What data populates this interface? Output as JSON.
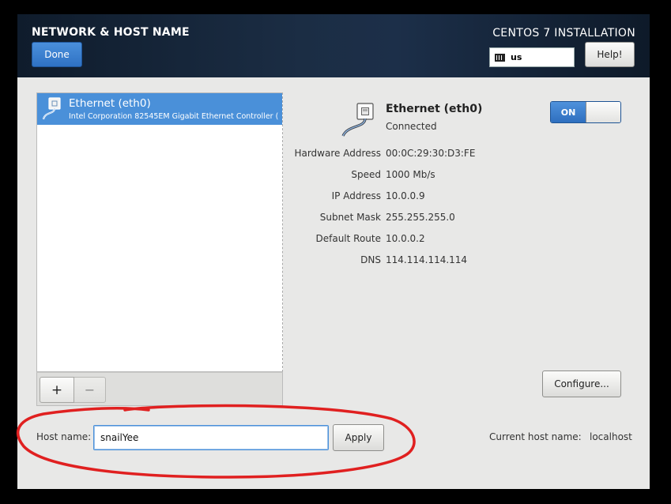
{
  "header": {
    "title": "NETWORK & HOST NAME",
    "done_label": "Done",
    "install_title": "CENTOS 7 INSTALLATION",
    "keyboard_layout": "us",
    "help_label": "Help!"
  },
  "device_list": {
    "items": [
      {
        "name": "Ethernet (eth0)",
        "description": "Intel Corporation 82545EM Gigabit Ethernet Controller ("
      }
    ],
    "add_label": "+",
    "remove_label": "−"
  },
  "detail": {
    "name": "Ethernet (eth0)",
    "status": "Connected",
    "toggle_label": "ON",
    "properties": [
      {
        "label": "Hardware Address",
        "value": "00:0C:29:30:D3:FE"
      },
      {
        "label": "Speed",
        "value": "1000 Mb/s"
      },
      {
        "label": "IP Address",
        "value": "10.0.0.9"
      },
      {
        "label": "Subnet Mask",
        "value": "255.255.255.0"
      },
      {
        "label": "Default Route",
        "value": "10.0.0.2"
      },
      {
        "label": "DNS",
        "value": "114.114.114.114"
      }
    ],
    "configure_label": "Configure..."
  },
  "hostname": {
    "label": "Host name:",
    "value": "snailYee",
    "apply_label": "Apply",
    "current_label": "Current host name:",
    "current_value": "localhost"
  },
  "colors": {
    "accent": "#4a90d9",
    "header_bg": "#1b2d44",
    "annotation": "#e02020"
  },
  "icons": {
    "device": "ethernet-cable-icon",
    "keyboard": "keyboard-icon"
  }
}
